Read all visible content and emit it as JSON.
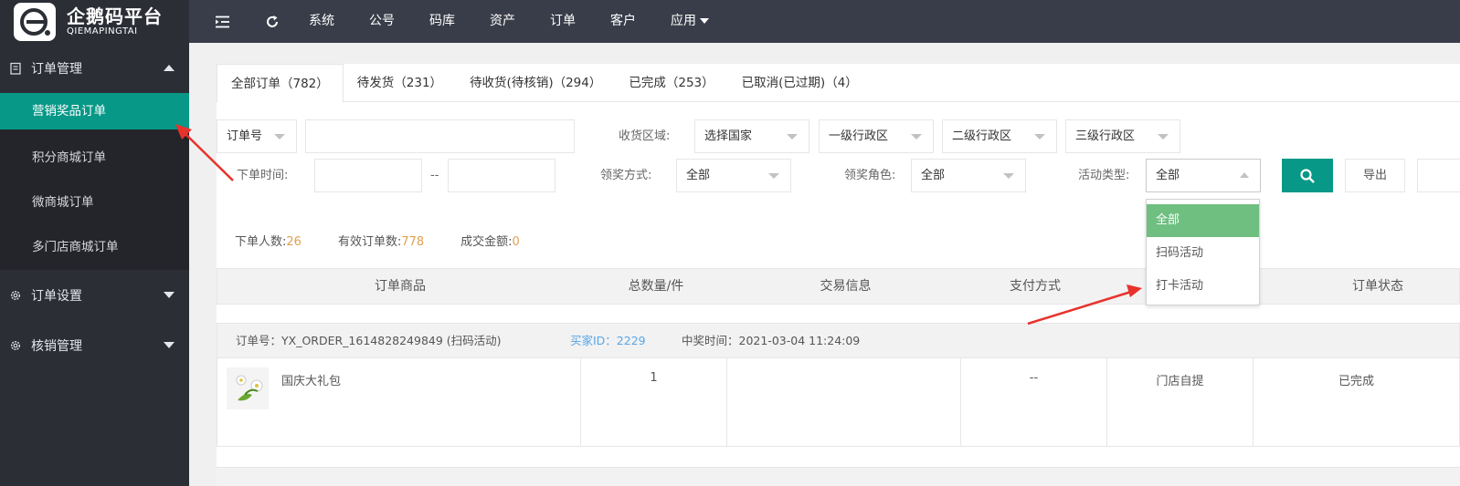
{
  "logo": {
    "cn": "企鹅码平台",
    "en": "QIEMAPINGTAI"
  },
  "sidebar": {
    "groups": [
      {
        "label": "订单管理",
        "expanded": true
      },
      {
        "label": "订单设置",
        "expanded": false
      },
      {
        "label": "核销管理",
        "expanded": false
      }
    ],
    "items": [
      {
        "label": "营销奖品订单",
        "active": true
      },
      {
        "label": "积分商城订单"
      },
      {
        "label": "微商城订单"
      },
      {
        "label": "多门店商城订单"
      }
    ]
  },
  "topbar": {
    "nav": [
      "系统",
      "公号",
      "码库",
      "资产",
      "订单",
      "客户",
      "应用"
    ]
  },
  "tabs": [
    "全部订单（782）",
    "待发货（231）",
    "待收货(待核销)（294）",
    "已完成（253）",
    "已取消(已过期)（4）"
  ],
  "filters": {
    "order_select": "订单号",
    "order_input": "",
    "region_label": "收货区域:",
    "country": "选择国家",
    "level1": "一级行政区",
    "level2": "二级行政区",
    "level3": "三级行政区",
    "time_label": "下单时间:",
    "time_sep": "--",
    "method_label": "领奖方式:",
    "method_value": "全部",
    "role_label": "领奖角色:",
    "role_value": "全部",
    "activity_label": "活动类型:",
    "activity_value": "全部",
    "export_label": "导出"
  },
  "dropdown": {
    "options": [
      "全部",
      "扫码活动",
      "打卡活动"
    ],
    "selected": "全部"
  },
  "stats": [
    {
      "label": "下单人数:",
      "value": "26"
    },
    {
      "label": "有效订单数:",
      "value": "778"
    },
    {
      "label": "成交金额:",
      "value": "0"
    }
  ],
  "table": {
    "headers": [
      "订单商品",
      "总数量/件",
      "交易信息",
      "支付方式",
      "订单状态"
    ]
  },
  "order": {
    "order_no": "订单号：YX_ORDER_1614828249849 (扫码活动)",
    "buyer": "买家ID：2229",
    "win_time": "中奖时间：2021-03-04 11:24:09",
    "product": "国庆大礼包",
    "qty": "1",
    "trade": "",
    "payment": "--",
    "delivery": "门店自提",
    "status": "已完成"
  },
  "colors": {
    "accent": "#079887",
    "sidebar": "#2b2e35",
    "topbar": "#393d49",
    "selected_option": "#6fbf80",
    "arrow": "#e8322c",
    "stat_value": "#e0a050"
  }
}
